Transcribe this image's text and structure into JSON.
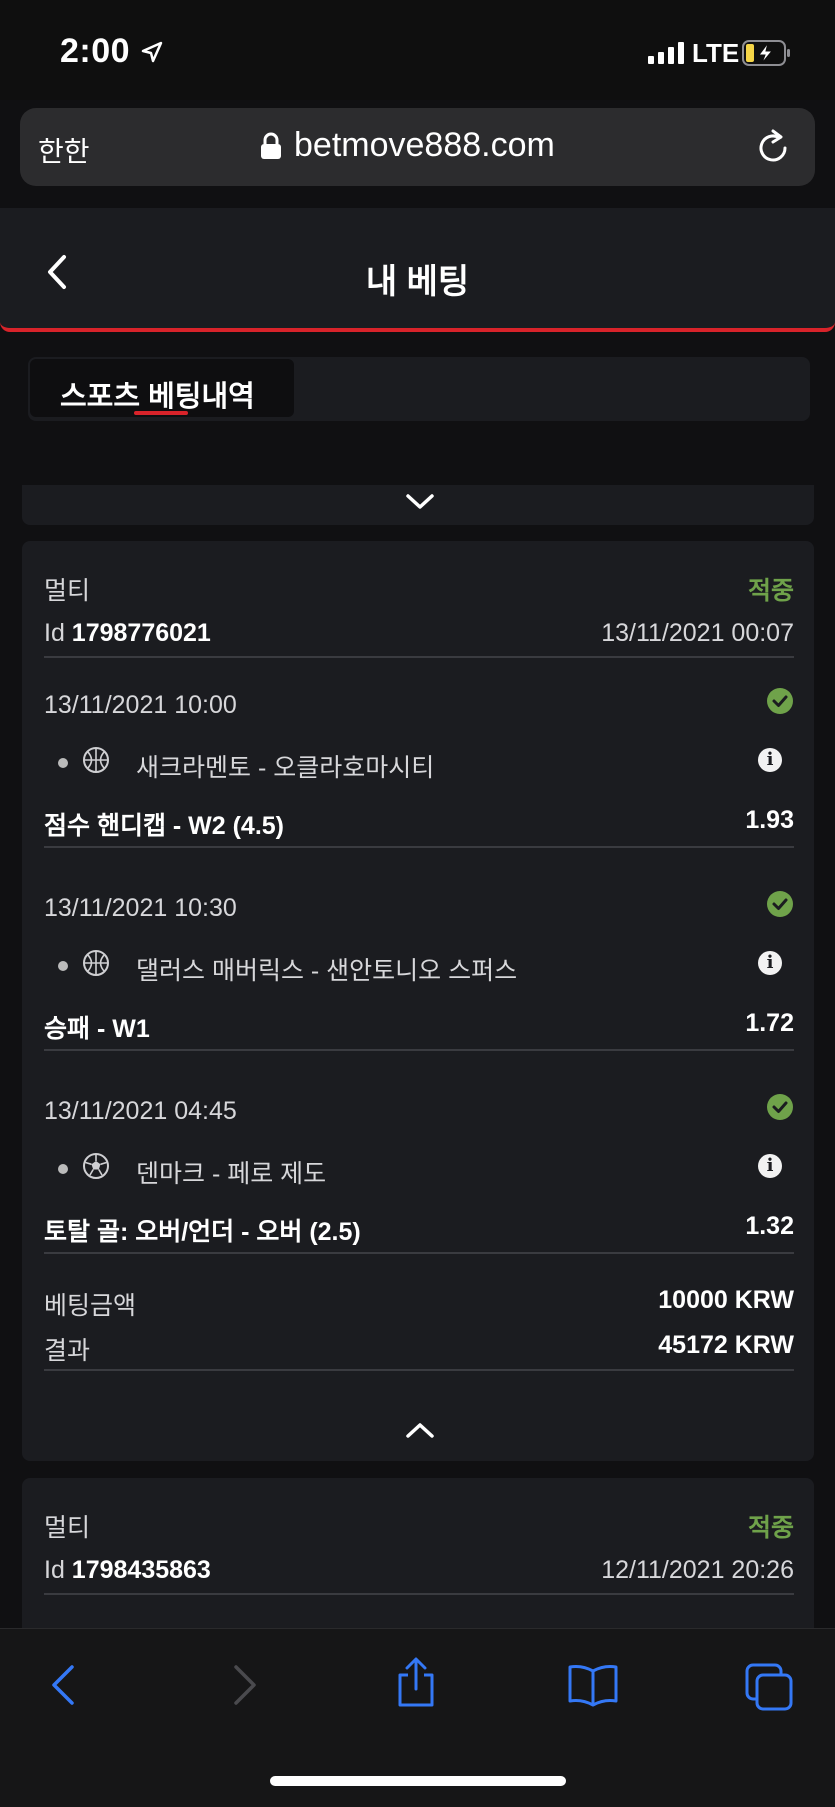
{
  "status_bar": {
    "time": "2:00",
    "network": "LTE"
  },
  "browser": {
    "reader_label": "한한",
    "url": "betmove888.com"
  },
  "header": {
    "title": "내 베팅"
  },
  "tabs": [
    {
      "label": "스포츠 베팅내역",
      "active": true
    }
  ],
  "bets": [
    {
      "type": "멀티",
      "status": "적중",
      "id_label": "Id",
      "id": "1798776021",
      "placed_at": "13/11/2021 00:07",
      "events": [
        {
          "date": "13/11/2021 10:00",
          "sport": "basketball-icon",
          "teams": "새크라멘토 - 오클라호마시티",
          "market": "점수 핸디캡 - W2 (4.5)",
          "odds": "1.93",
          "result": "won"
        },
        {
          "date": "13/11/2021 10:30",
          "sport": "basketball-icon",
          "teams": "댈러스 매버릭스 - 샌안토니오 스퍼스",
          "market": "승패 - W1",
          "odds": "1.72",
          "result": "won"
        },
        {
          "date": "13/11/2021 04:45",
          "sport": "soccer-ball-icon",
          "teams": "덴마크 - 페로 제도",
          "market": "토탈 골: 오버/언더 - 오버 (2.5)",
          "odds": "1.32",
          "result": "won"
        }
      ],
      "stake_label": "베팅금액",
      "stake": "10000 KRW",
      "result_label": "결과",
      "payout": "45172 KRW"
    },
    {
      "type": "멀티",
      "status": "적중",
      "id_label": "Id",
      "id": "1798435863",
      "placed_at": "12/11/2021 20:26"
    }
  ],
  "colors": {
    "accent_red": "#d8232a",
    "won_green": "#6fa24a",
    "ios_blue": "#3478f6"
  }
}
